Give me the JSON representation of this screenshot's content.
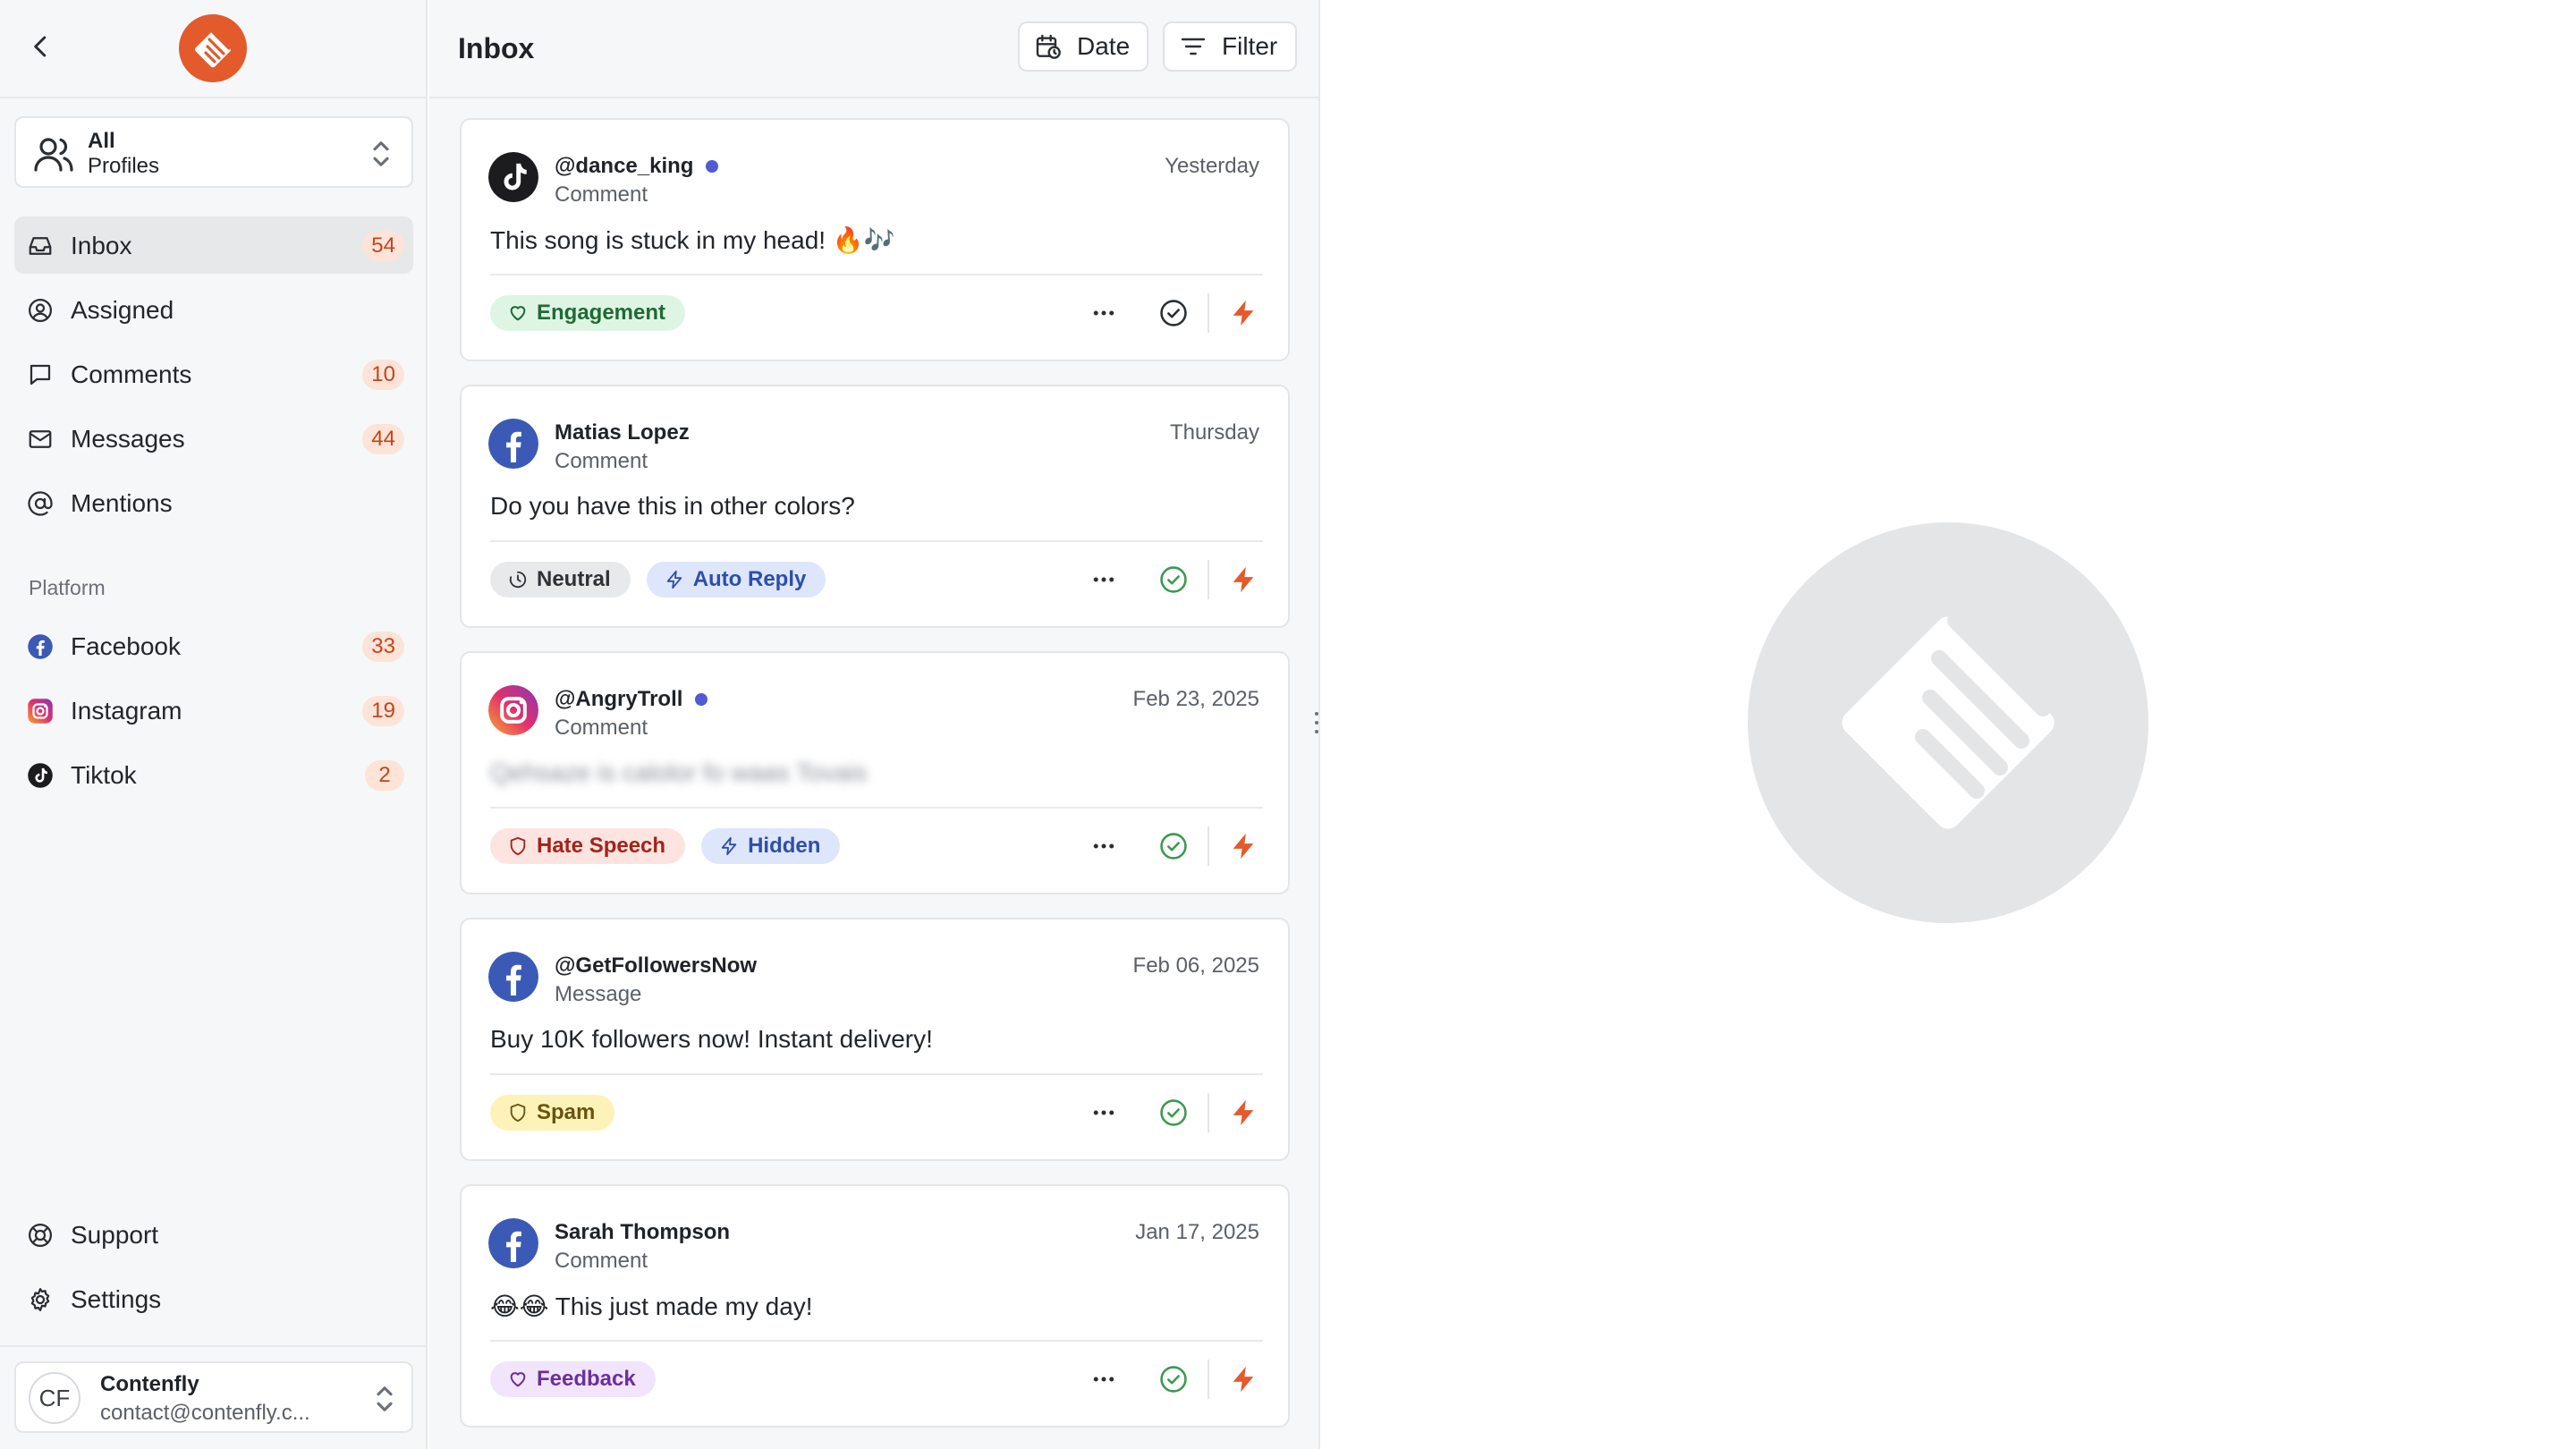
{
  "sidebar": {
    "profile_switch": {
      "line1": "All",
      "line2": "Profiles"
    },
    "nav": [
      {
        "label": "Inbox",
        "badge": "54"
      },
      {
        "label": "Assigned",
        "badge": ""
      },
      {
        "label": "Comments",
        "badge": "10"
      },
      {
        "label": "Messages",
        "badge": "44"
      },
      {
        "label": "Mentions",
        "badge": ""
      }
    ],
    "platform_label": "Platform",
    "platforms": [
      {
        "label": "Facebook",
        "badge": "33"
      },
      {
        "label": "Instagram",
        "badge": "19"
      },
      {
        "label": "Tiktok",
        "badge": "2"
      }
    ],
    "support_label": "Support",
    "settings_label": "Settings",
    "account": {
      "initials": "CF",
      "name": "Contenfly",
      "email": "contact@contenfly.c..."
    }
  },
  "inbox": {
    "title": "Inbox",
    "date_label": "Date",
    "filter_label": "Filter",
    "items": [
      {
        "platform": "tiktok",
        "name": "@dance_king",
        "unread": true,
        "type": "Comment",
        "date": "Yesterday",
        "text": "This song is stuck in my head! 🔥🎶",
        "tags": [
          {
            "label": "Engagement",
            "style": "green",
            "icon": "heart-icon"
          }
        ]
      },
      {
        "platform": "facebook",
        "name": "Matias Lopez",
        "unread": false,
        "type": "Comment",
        "date": "Thursday",
        "text": "Do you have this in other colors?",
        "tags": [
          {
            "label": "Neutral",
            "style": "gray",
            "icon": "neutral-icon"
          },
          {
            "label": "Auto Reply",
            "style": "blue",
            "icon": "bolt-icon"
          }
        ]
      },
      {
        "platform": "instagram",
        "name": "@AngryTroll",
        "unread": true,
        "type": "Comment",
        "date": "Feb 23, 2025",
        "text": "Qehsaze is calolor fo waas Tovais",
        "tags": [
          {
            "label": "Hate Speech",
            "style": "red",
            "icon": "shield-icon"
          },
          {
            "label": "Hidden",
            "style": "blue",
            "icon": "bolt-icon"
          }
        ]
      },
      {
        "platform": "facebook",
        "name": "@GetFollowersNow",
        "unread": false,
        "type": "Message",
        "date": "Feb 06, 2025",
        "text": "Buy 10K followers now! Instant delivery!",
        "tags": [
          {
            "label": "Spam",
            "style": "yellow",
            "icon": "shield-icon"
          }
        ]
      },
      {
        "platform": "facebook",
        "name": "Sarah Thompson",
        "unread": false,
        "type": "Comment",
        "date": "Jan 17, 2025",
        "text": "😂😂 This just made my day!",
        "tags": [
          {
            "label": "Feedback",
            "style": "purple",
            "icon": "heart-icon"
          }
        ]
      }
    ]
  },
  "colors": {
    "brand": "#e35a2c",
    "badge_bg": "#fde3d8",
    "badge_text": "#c2461c",
    "unread_dot": "#4f5bd5"
  }
}
